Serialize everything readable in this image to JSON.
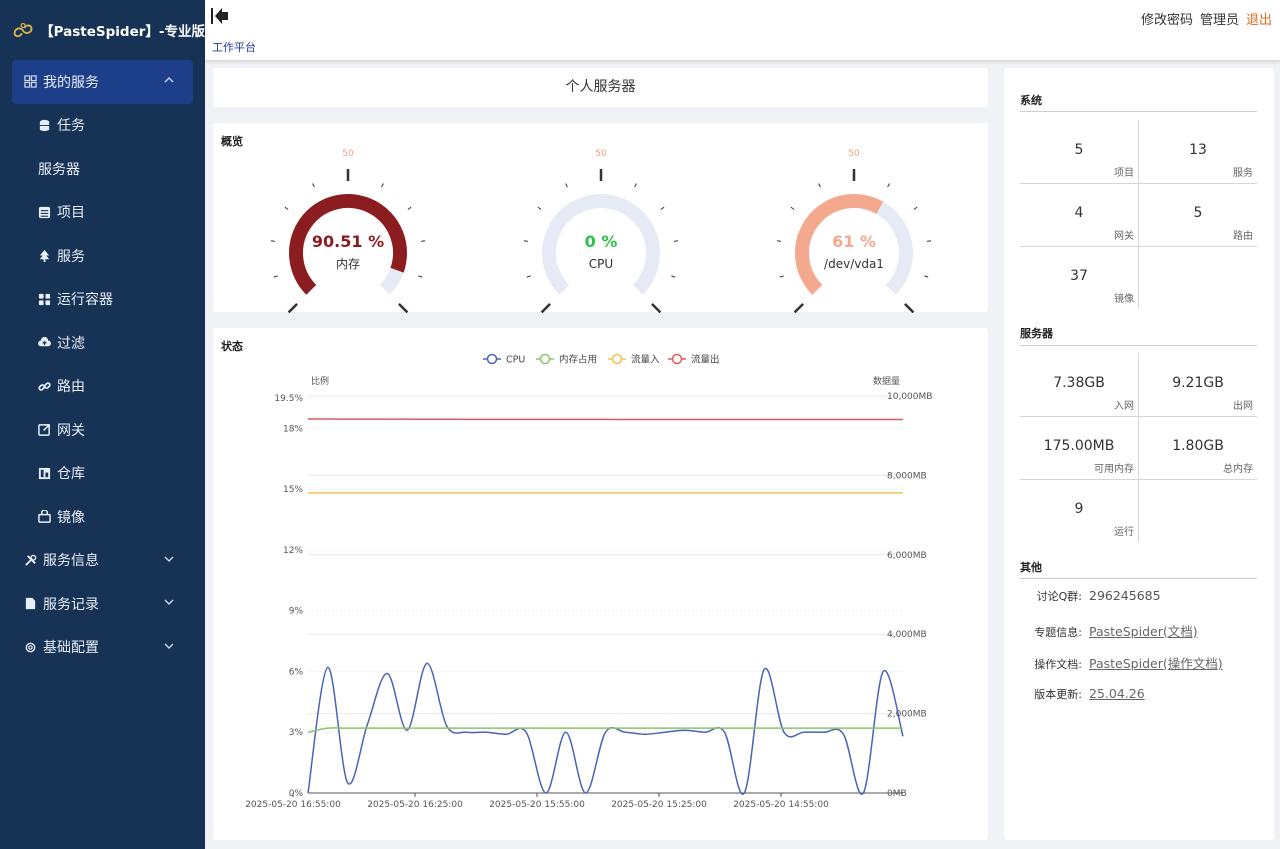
{
  "brand": {
    "name": "【PasteSpider】-专业版"
  },
  "sidebar": {
    "items": [
      {
        "label": "我的服务",
        "icon": "grid-icon",
        "level": "top",
        "active": true,
        "chevron": "up"
      },
      {
        "label": "任务",
        "icon": "database-icon",
        "level": "sub"
      },
      {
        "label": "服务器",
        "icon": "",
        "level": "sub"
      },
      {
        "label": "项目",
        "icon": "list-icon",
        "level": "sub"
      },
      {
        "label": "服务",
        "icon": "tree-icon",
        "level": "sub"
      },
      {
        "label": "运行容器",
        "icon": "apps-icon",
        "level": "sub"
      },
      {
        "label": "过滤",
        "icon": "cloud-icon",
        "level": "sub"
      },
      {
        "label": "路由",
        "icon": "link-icon",
        "level": "sub"
      },
      {
        "label": "网关",
        "icon": "external-icon",
        "level": "sub"
      },
      {
        "label": "仓库",
        "icon": "warehouse-icon",
        "level": "sub"
      },
      {
        "label": "镜像",
        "icon": "bag-icon",
        "level": "sub"
      },
      {
        "label": "服务信息",
        "icon": "tools-icon",
        "level": "top",
        "chevron": "down"
      },
      {
        "label": "服务记录",
        "icon": "file-icon",
        "level": "top",
        "chevron": "down"
      },
      {
        "label": "基础配置",
        "icon": "gear-icon",
        "level": "top",
        "chevron": "down"
      }
    ]
  },
  "header": {
    "breadcrumb": "工作平台",
    "change_password": "修改密码",
    "user": "管理员",
    "logout": "退出"
  },
  "main": {
    "title": "个人服务器",
    "overview_title": "概览",
    "status_title": "状态"
  },
  "gauges": [
    {
      "value": 90.51,
      "value_text": "90.51 %",
      "label": "内存",
      "color": "#8b1c1f",
      "min": "0",
      "mid": "50",
      "max": "100"
    },
    {
      "value": 0,
      "value_text": "0 %",
      "label": "CPU",
      "color": "#2ec24a",
      "min": "0",
      "mid": "50",
      "max": "100"
    },
    {
      "value": 61,
      "value_text": "61 %",
      "label": "/dev/vda1",
      "color": "#f4a88e",
      "min": "0",
      "mid": "50",
      "max": "100"
    }
  ],
  "chart_data": {
    "type": "line",
    "legend": [
      "CPU",
      "内存占用",
      "流量入",
      "流量出"
    ],
    "legend_position": "top-center",
    "ylabel_left": "比例",
    "ylabel_right": "数据量",
    "y_left_ticks": [
      "19.5%",
      "18%",
      "15%",
      "12%",
      "9%",
      "6%",
      "3%",
      "0%"
    ],
    "y_left_range": [
      0,
      19.5
    ],
    "y_right_ticks": [
      "10,000MB",
      "8,000MB",
      "6,000MB",
      "4,000MB",
      "2,000MB",
      "0MB"
    ],
    "y_right_range": [
      0,
      10000
    ],
    "x_ticks": [
      "2025-05-20 16:55:00",
      "2025-05-20 16:25:00",
      "2025-05-20 15:55:00",
      "2025-05-20 15:25:00",
      "2025-05-20 14:55:00"
    ],
    "series": [
      {
        "name": "CPU",
        "axis": "left",
        "color": "#4a63b6",
        "values": [
          0,
          6.2,
          0.5,
          3.4,
          5.9,
          3.1,
          6.4,
          3.3,
          3.0,
          3.0,
          2.9,
          3.0,
          0,
          3.0,
          0,
          3.0,
          3.0,
          2.9,
          3.0,
          3.1,
          3.0,
          3.0,
          0,
          6.1,
          3.0,
          3.0,
          3.0,
          2.9,
          0,
          6.0,
          2.8
        ]
      },
      {
        "name": "内存占用",
        "axis": "left",
        "color": "#88c765",
        "values": [
          3.0,
          3.2,
          3.2,
          3.2,
          3.2,
          3.2,
          3.2,
          3.2,
          3.2,
          3.2,
          3.2,
          3.2,
          3.2,
          3.2,
          3.2,
          3.2,
          3.2,
          3.2,
          3.2,
          3.2,
          3.2,
          3.2,
          3.2,
          3.2,
          3.2,
          3.2,
          3.2,
          3.2,
          3.2,
          3.2,
          3.2
        ]
      },
      {
        "name": "流量入",
        "axis": "right",
        "color": "#f2c14e",
        "values": [
          7560,
          7560,
          7560,
          7560,
          7560,
          7560,
          7560,
          7560,
          7560,
          7560,
          7560,
          7560,
          7560,
          7560,
          7560,
          7560,
          7560,
          7560,
          7560,
          7560,
          7560,
          7560,
          7560,
          7560,
          7560,
          7560,
          7560,
          7560,
          7560,
          7560,
          7560
        ]
      },
      {
        "name": "流量出",
        "axis": "right",
        "color": "#e05a5a",
        "values": [
          9420,
          9420,
          9418,
          9418,
          9416,
          9416,
          9414,
          9414,
          9412,
          9412,
          9410,
          9410,
          9410,
          9410,
          9410,
          9410,
          9408,
          9408,
          9408,
          9408,
          9408,
          9408,
          9408,
          9408,
          9408,
          9408,
          9408,
          9408,
          9408,
          9408,
          9408
        ]
      }
    ]
  },
  "system": {
    "title": "系统",
    "cells": [
      {
        "value": "5",
        "label": "项目"
      },
      {
        "value": "13",
        "label": "服务"
      },
      {
        "value": "4",
        "label": "网关"
      },
      {
        "value": "5",
        "label": "路由"
      },
      {
        "value": "37",
        "label": "镜像"
      }
    ]
  },
  "server": {
    "title": "服务器",
    "cells": [
      {
        "value": "7.38GB",
        "label": "入网"
      },
      {
        "value": "9.21GB",
        "label": "出网"
      },
      {
        "value": "175.00MB",
        "label": "可用内存"
      },
      {
        "value": "1.80GB",
        "label": "总内存"
      },
      {
        "value": "9",
        "label": "运行"
      }
    ]
  },
  "other": {
    "title": "其他",
    "rows": [
      {
        "key": "讨论Q群:",
        "value": "296245685",
        "link": false
      },
      {
        "key": "专题信息:",
        "value": "PasteSpider(文档)",
        "link": true
      },
      {
        "key": "操作文档:",
        "value": "PasteSpider(操作文档)",
        "link": true
      },
      {
        "key": "版本更新:",
        "value": "25.04.26",
        "link": true
      }
    ]
  }
}
